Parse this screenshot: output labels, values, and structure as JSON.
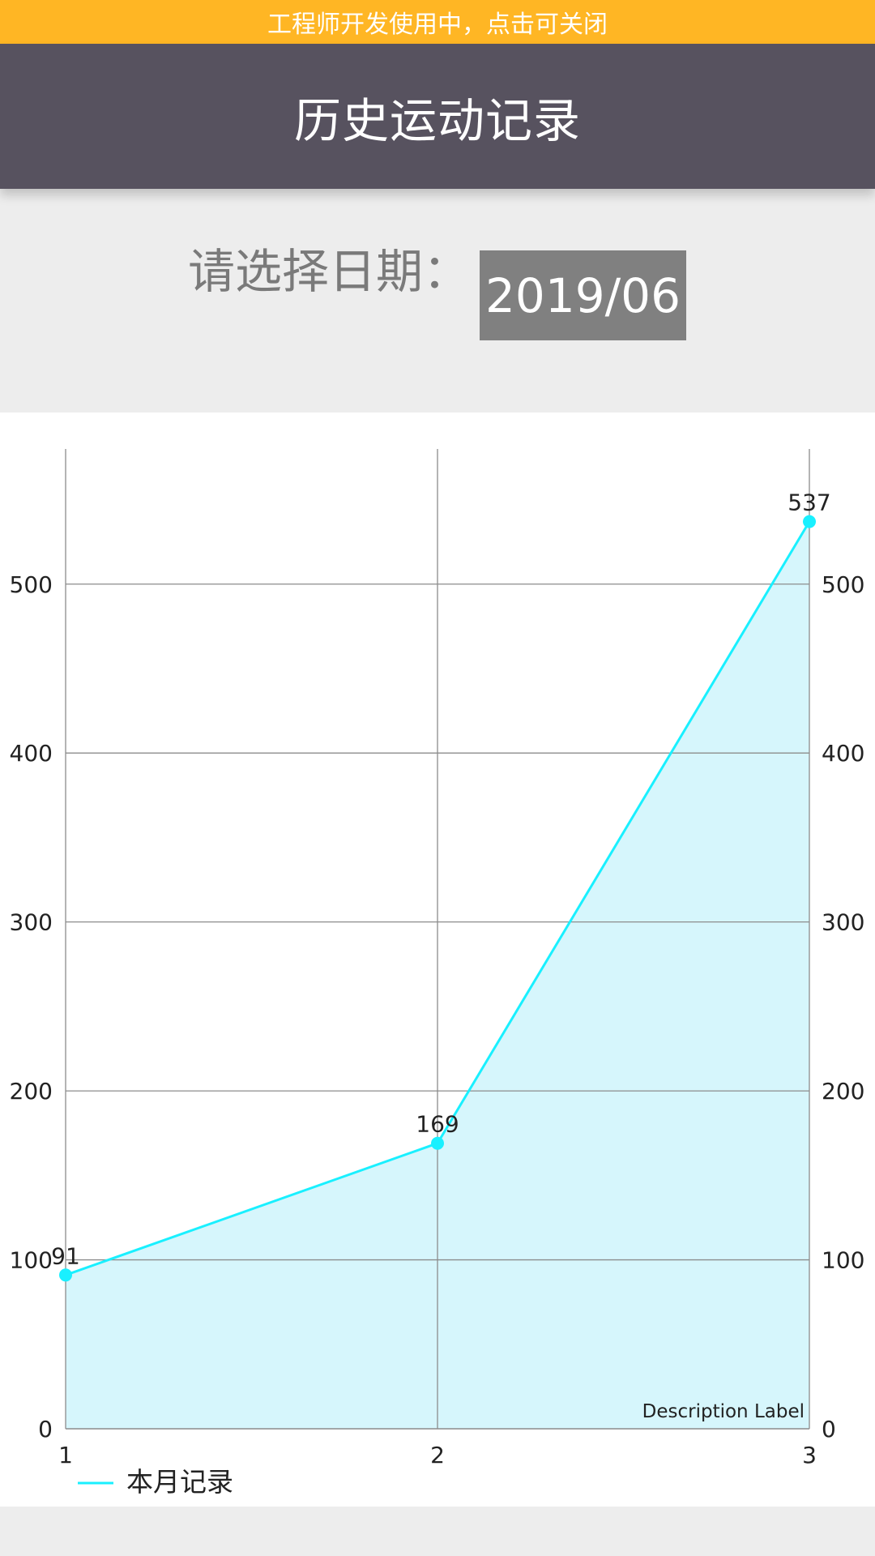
{
  "banner": {
    "text": "工程师开发使用中，点击可关闭"
  },
  "header": {
    "title": "历史运动记录"
  },
  "date_picker": {
    "label": "请选择日期：",
    "value": "2019/06"
  },
  "colors": {
    "banner": "#ffb624",
    "header": "#57525f",
    "line": "#19f0ff",
    "fill": "#d6f6fc",
    "date_button": "#808080"
  },
  "chart_data": {
    "type": "area",
    "x": [
      1,
      2,
      3
    ],
    "series": [
      {
        "name": "本月记录",
        "values": [
          91,
          169,
          537
        ]
      }
    ],
    "xlim": [
      1,
      3
    ],
    "ylim": [
      0,
      580
    ],
    "y_ticks": [
      0,
      100,
      200,
      300,
      400,
      500
    ],
    "x_ticks": [
      1,
      2,
      3
    ],
    "dual_y_axis": true,
    "grid": true,
    "legend": "bottom-left",
    "description": "Description Label"
  }
}
